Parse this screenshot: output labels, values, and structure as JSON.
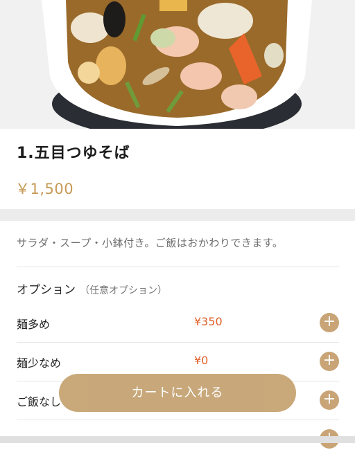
{
  "product": {
    "title": "1.五目つゆそば",
    "price": "￥1,500",
    "description": "サラダ・スープ・小鉢付き。ご飯はおかわりできます。"
  },
  "options": {
    "heading": "オプション",
    "subheading": "（任意オプション）",
    "items": [
      {
        "name": "麺多め",
        "price": "¥350"
      },
      {
        "name": "麺少なめ",
        "price": "¥0"
      },
      {
        "name": "ご飯なし",
        "price": ""
      },
      {
        "name": "",
        "price": ""
      }
    ],
    "add_symbol": "+"
  },
  "cart": {
    "button_label": "カートに入れる"
  },
  "colors": {
    "accent": "#c7a676",
    "price_gold": "#c79a55",
    "option_price": "#e0602a"
  },
  "icons": {
    "add": "plus-icon"
  }
}
